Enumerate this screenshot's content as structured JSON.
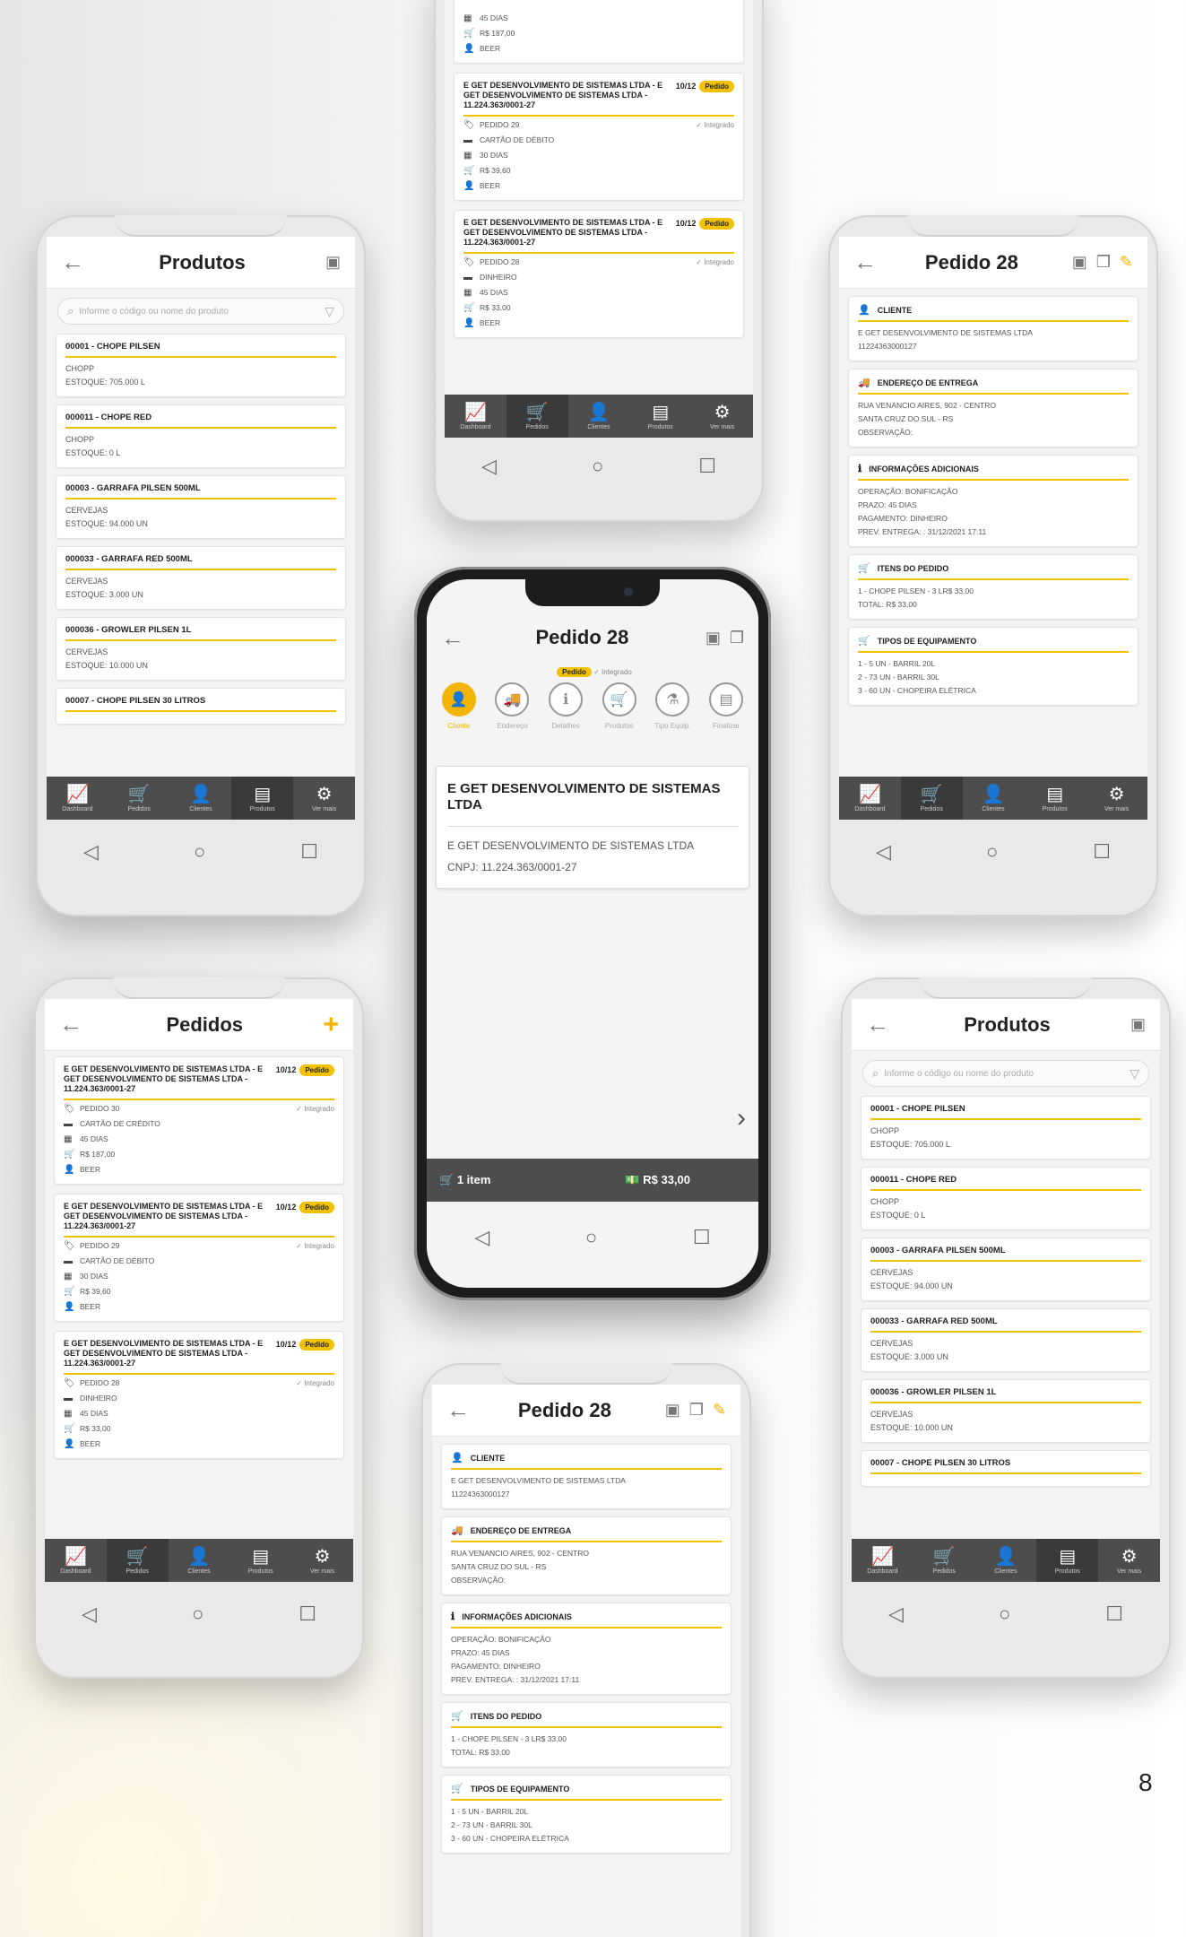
{
  "page_number": "8",
  "nav_labels": [
    "Dashboard",
    "Pedidos",
    "Clientes",
    "Produtos",
    "Ver mais"
  ],
  "android_nav": {
    "back": "◁",
    "home": "○",
    "recent": "☐"
  },
  "products_screen": {
    "title": "Produtos",
    "search_placeholder": "Informe o código ou nome do produto",
    "items": [
      {
        "title": "00001 - CHOPE PILSEN",
        "category": "CHOPP",
        "stock": "ESTOQUE: 705.000 L"
      },
      {
        "title": "000011 - CHOPE RED",
        "category": "CHOPP",
        "stock": "ESTOQUE: 0 L"
      },
      {
        "title": "00003 - GARRAFA PILSEN 500ML",
        "category": "CERVEJAS",
        "stock": "ESTOQUE: 94.000 UN"
      },
      {
        "title": "000033 - GARRAFA RED 500ML",
        "category": "CERVEJAS",
        "stock": "ESTOQUE: 3.000 UN"
      },
      {
        "title": "000036 - GROWLER PILSEN 1L",
        "category": "CERVEJAS",
        "stock": "ESTOQUE: 10.000 UN"
      },
      {
        "title": "00007 - CHOPE PILSEN 30 LITROS",
        "category": "",
        "stock": ""
      }
    ]
  },
  "orders_screen": {
    "title": "Pedidos",
    "add": "+",
    "badge": "Pedido",
    "integrated": "Integrado",
    "orders": [
      {
        "name": "E GET DESENVOLVIMENTO DE SISTEMAS LTDA - E GET DESENVOLVIMENTO DE SISTEMAS LTDA - 11.224.363/0001-27",
        "date": "10/12",
        "number": "PEDIDO 30",
        "payment": "CARTÃO DE CRÉDITO",
        "term": "45 DIAS",
        "total": "R$ 187,00",
        "user": "BEER"
      },
      {
        "name": "E GET DESENVOLVIMENTO DE SISTEMAS LTDA - E GET DESENVOLVIMENTO DE SISTEMAS LTDA - 11.224.363/0001-27",
        "date": "10/12",
        "number": "PEDIDO 29",
        "payment": "CARTÃO DE DÉBITO",
        "term": "30 DIAS",
        "total": "R$ 39,60",
        "user": "BEER"
      },
      {
        "name": "E GET DESENVOLVIMENTO DE SISTEMAS LTDA - E GET DESENVOLVIMENTO DE SISTEMAS LTDA - 11.224.363/0001-27",
        "date": "10/12",
        "number": "PEDIDO 28",
        "payment": "DINHEIRO",
        "term": "45 DIAS",
        "total": "R$ 33,00",
        "user": "BEER"
      }
    ],
    "top_partial": {
      "term": "45 DIAS",
      "total": "R$ 187,00",
      "user": "BEER"
    }
  },
  "detail_screen": {
    "title": "Pedido 28",
    "sections": [
      {
        "icon": "person-icon",
        "glyph": "👤",
        "title": "CLIENTE",
        "lines": [
          "E GET DESENVOLVIMENTO DE SISTEMAS LTDA",
          "11224363000127"
        ]
      },
      {
        "icon": "truck-icon",
        "glyph": "🚚",
        "title": "ENDEREÇO DE ENTREGA",
        "lines": [
          "RUA VENANCIO AIRES, 902 - CENTRO",
          "SANTA CRUZ DO SUL - RS",
          "OBSERVAÇÃO:"
        ]
      },
      {
        "icon": "info-icon",
        "glyph": "ℹ",
        "title": "INFORMAÇÕES ADICIONAIS",
        "lines": [
          "OPERAÇÃO: BONIFICAÇÃO",
          "PRAZO: 45 DIAS",
          "PAGAMENTO: DINHEIRO",
          "PREV. ENTREGA: : 31/12/2021 17:11"
        ]
      },
      {
        "icon": "cart-icon",
        "glyph": "🛒",
        "title": "ITENS DO PEDIDO",
        "lines": [
          "1 - CHOPE PILSEN - 3 LR$ 33.00",
          "TOTAL: R$ 33,00"
        ]
      },
      {
        "icon": "cart-icon",
        "glyph": "🛒",
        "title": "TIPOS DE EQUIPAMENTO",
        "lines": [
          "1 - 5 UN - BARRIL 20L",
          "2 - 73 UN - BARRIL 30L",
          "3 - 60 UN - CHOPEIRA ELÉTRICA"
        ]
      }
    ]
  },
  "wizard_screen": {
    "title": "Pedido 28",
    "badge": "Pedido",
    "integrated": "Integrado",
    "steps": [
      "Cliente",
      "Endereço",
      "Detalhes",
      "Produtos",
      "Tipo Equip.",
      "Finalizar"
    ],
    "company_title": "E GET DESENVOLVIMENTO DE SISTEMAS LTDA",
    "company_name": "E GET DESENVOLVIMENTO DE SISTEMAS LTDA",
    "cnpj": "CNPJ: 11.224.363/0001-27",
    "cart_items": "1 item",
    "cart_total": "R$ 33,00",
    "next": "›"
  }
}
